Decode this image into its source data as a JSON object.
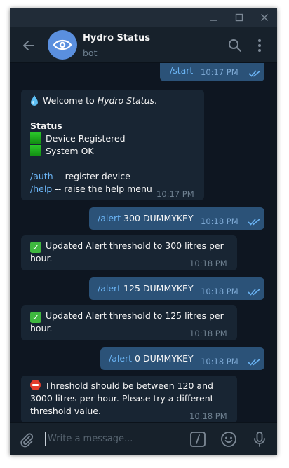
{
  "window": {
    "controls": {
      "minimize": "minimize-icon",
      "maximize": "maximize-icon",
      "close": "close-icon"
    }
  },
  "header": {
    "title": "Hydro Status",
    "subtitle": "bot",
    "icons": [
      "back-arrow-icon",
      "eye-icon",
      "search-icon",
      "more-vertical-icon"
    ]
  },
  "messages": [
    {
      "side": "out",
      "command": "/start",
      "time": "10:17 PM"
    },
    {
      "side": "in",
      "welcome_prefix": "Welcome to ",
      "welcome_name": "Hydro Status",
      "welcome_suffix": ".",
      "status_heading": "Status",
      "status_items": [
        "Device Registered",
        "System OK"
      ],
      "cmd_auth": "/auth",
      "cmd_auth_desc": " -- register device",
      "cmd_help": "/help",
      "cmd_help_desc": " -- raise the help menu",
      "time": "10:17 PM"
    },
    {
      "side": "out",
      "command": "/alert",
      "args": " 300 DUMMYKEY",
      "time": "10:18 PM"
    },
    {
      "side": "in",
      "line1": "Updated Alert threshold to 300 litres per",
      "line2": "hour.",
      "time": "10:18 PM"
    },
    {
      "side": "out",
      "command": "/alert",
      "args": " 125 DUMMYKEY",
      "time": "10:18 PM"
    },
    {
      "side": "in",
      "line1": "Updated Alert threshold to 125 litres per",
      "line2": "hour.",
      "time": "10:18 PM"
    },
    {
      "side": "out",
      "command": "/alert",
      "args": " 0 DUMMYKEY",
      "time": "10:18 PM"
    },
    {
      "side": "in",
      "line1": "Threshold should be between 120 and",
      "line2": "3000 litres per hour. Please try a different",
      "line3": "threshold value.",
      "time": "10:18 PM"
    }
  ],
  "composer": {
    "placeholder": "Write a message...",
    "icons": [
      "paperclip-icon",
      "bot-command-icon",
      "emoji-icon",
      "microphone-icon"
    ]
  },
  "colors": {
    "chat_bg": "#0e1621",
    "incoming_bubble": "#182533",
    "outgoing_bubble": "#2b5278",
    "command_link": "#6ab3f3",
    "read_ticks": "#6ab3f3",
    "avatar": "#5a8fde"
  }
}
